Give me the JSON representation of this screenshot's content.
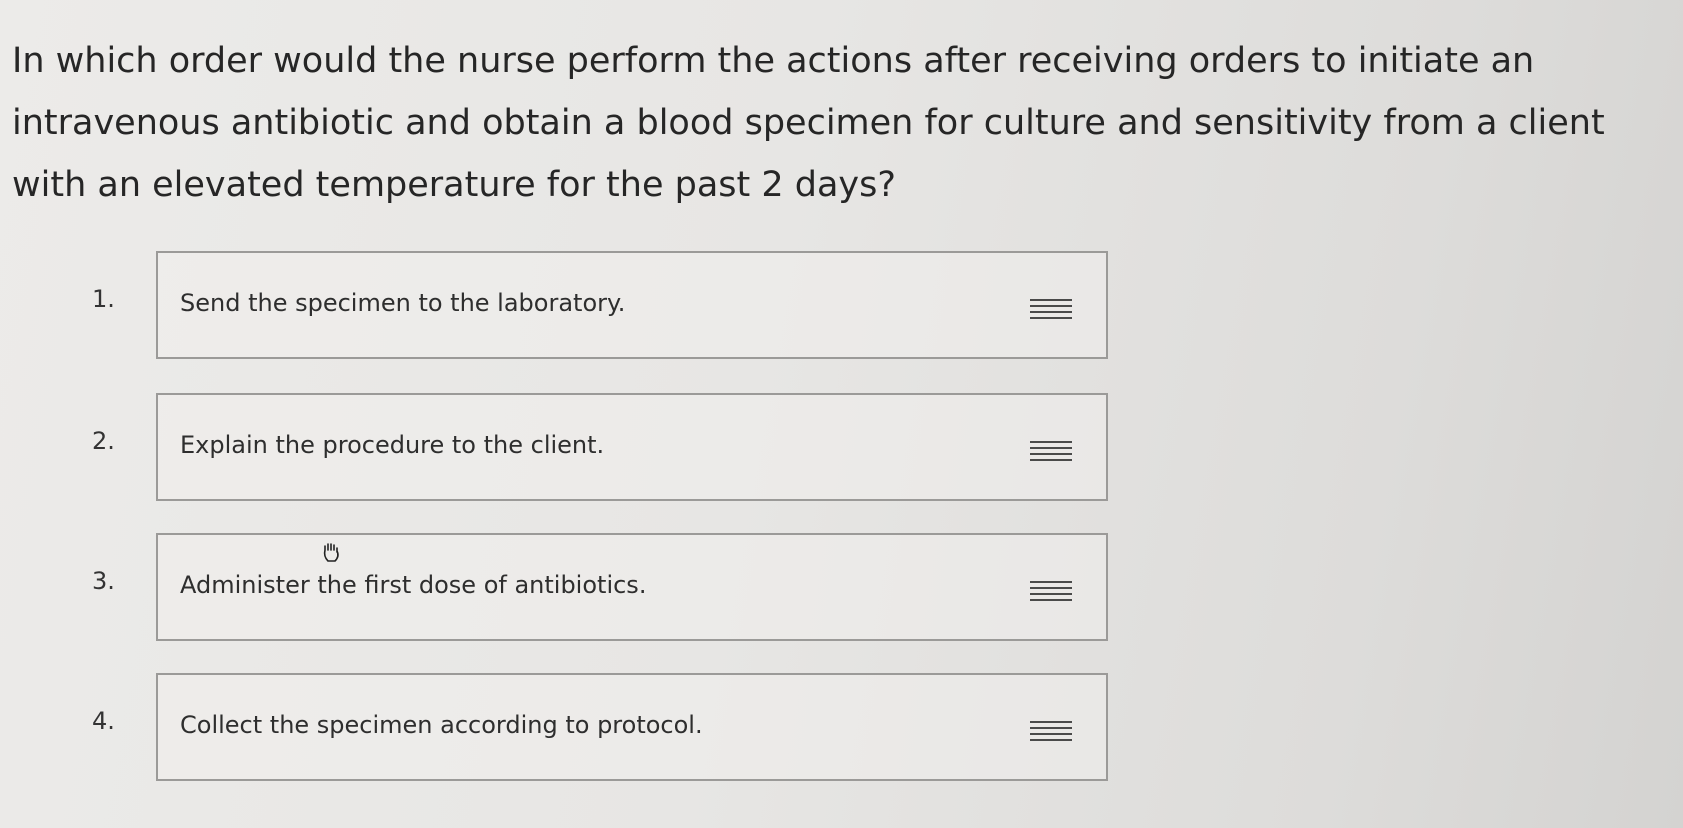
{
  "question": {
    "text": "In which order would the nurse perform the actions after receiving orders to initiate an intravenous antibiotic and obtain a blood specimen for culture and sensitivity from a client with an elevated temperature for the past 2 days?"
  },
  "options": [
    {
      "number": "1.",
      "text": "Send the specimen to the laboratory.",
      "handle_icon": "drag-handle-icon"
    },
    {
      "number": "2.",
      "text": "Explain the procedure to the client.",
      "handle_icon": "drag-handle-icon"
    },
    {
      "number": "3.",
      "text": "Administer the first dose of antibiotics.",
      "handle_icon": "drag-handle-icon"
    },
    {
      "number": "4.",
      "text": "Collect the specimen according to protocol.",
      "handle_icon": "drag-handle-icon"
    }
  ],
  "cursor": {
    "icon": "hand-grab-cursor-icon"
  },
  "colors": {
    "background": "#e7e6e4",
    "text": "#262626",
    "box_border": "#9b9a98",
    "handle": "#4a4a4a"
  }
}
